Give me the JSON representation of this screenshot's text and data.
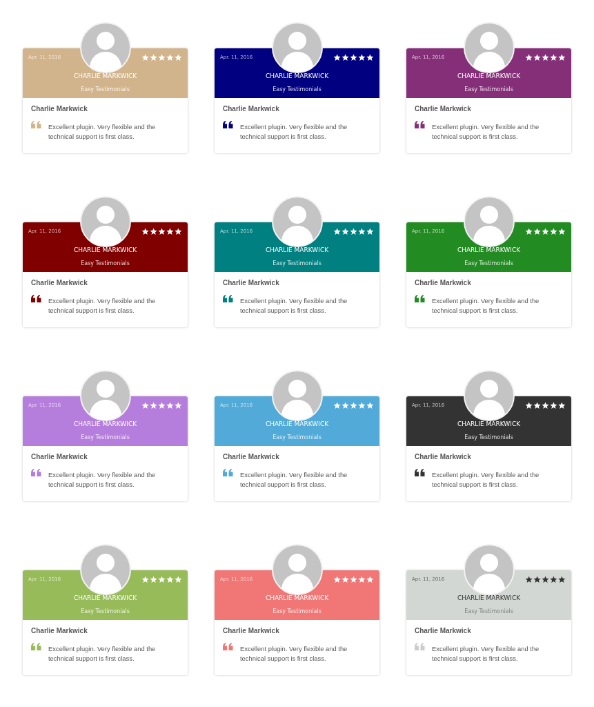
{
  "testimonials": [
    {
      "date": "Apr. 11, 2016",
      "stars": 5,
      "title": "CHARLIE MARKWICK",
      "source": "Easy Testimonials",
      "name": "Charlie Markwick",
      "quote": "Excellent plugin. Very flexible and the technical support is first class.",
      "color": "#d2b48c"
    },
    {
      "date": "Apr. 11, 2016",
      "stars": 5,
      "title": "CHARLIE MARKWICK",
      "source": "Easy Testimonials",
      "name": "Charlie Markwick",
      "quote": "Excellent plugin. Very flexible and the technical support is first class.",
      "color": "#000080"
    },
    {
      "date": "Apr. 11, 2016",
      "stars": 5,
      "title": "CHARLIE MARKWICK",
      "source": "Easy Testimonials",
      "name": "Charlie Markwick",
      "quote": "Excellent plugin. Very flexible and the technical support is first class.",
      "color": "#862f79"
    },
    {
      "date": "Apr. 11, 2016",
      "stars": 5,
      "title": "CHARLIE MARKWICK",
      "source": "Easy Testimonials",
      "name": "Charlie Markwick",
      "quote": "Excellent plugin. Very flexible and the technical support is first class.",
      "color": "#800000"
    },
    {
      "date": "Apr. 11, 2016",
      "stars": 5,
      "title": "CHARLIE MARKWICK",
      "source": "Easy Testimonials",
      "name": "Charlie Markwick",
      "quote": "Excellent plugin. Very flexible and the technical support is first class.",
      "color": "#008080"
    },
    {
      "date": "Apr. 11, 2016",
      "stars": 5,
      "title": "CHARLIE MARKWICK",
      "source": "Easy Testimonials",
      "name": "Charlie Markwick",
      "quote": "Excellent plugin. Very flexible and the technical support is first class.",
      "color": "#228b22"
    },
    {
      "date": "Apr. 11, 2016",
      "stars": 5,
      "title": "CHARLIE MARKWICK",
      "source": "Easy Testimonials",
      "name": "Charlie Markwick",
      "quote": "Excellent plugin. Very flexible and the technical support is first class.",
      "color": "#b57edc"
    },
    {
      "date": "Apr. 11, 2016",
      "stars": 5,
      "title": "CHARLIE MARKWICK",
      "source": "Easy Testimonials",
      "name": "Charlie Markwick",
      "quote": "Excellent plugin. Very flexible and the technical support is first class.",
      "color": "#51aad8"
    },
    {
      "date": "Apr. 11, 2016",
      "stars": 5,
      "title": "CHARLIE MARKWICK",
      "source": "Easy Testimonials",
      "name": "Charlie Markwick",
      "quote": "Excellent plugin. Very flexible and the technical support is first class.",
      "color": "#333333"
    },
    {
      "date": "Apr. 11, 2016",
      "stars": 5,
      "title": "CHARLIE MARKWICK",
      "source": "Easy Testimonials",
      "name": "Charlie Markwick",
      "quote": "Excellent plugin. Very flexible and the technical support is first class.",
      "color": "#97bb59"
    },
    {
      "date": "Apr. 11, 2016",
      "stars": 5,
      "title": "CHARLIE MARKWICK",
      "source": "Easy Testimonials",
      "name": "Charlie Markwick",
      "quote": "Excellent plugin. Very flexible and the technical support is first class.",
      "color": "#f07775"
    },
    {
      "date": "Apr. 11, 2016",
      "stars": 5,
      "title": "CHARLIE MARKWICK",
      "source": "Easy Testimonials",
      "name": "Charlie Markwick",
      "quote": "Excellent plugin. Very flexible and the technical support is first class.",
      "color": "#d3d7d4"
    }
  ]
}
